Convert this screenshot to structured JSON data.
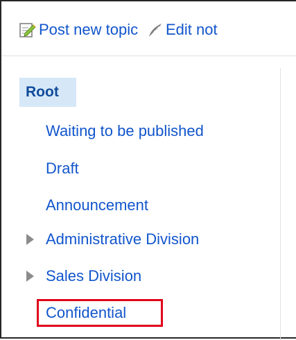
{
  "toolbar": {
    "post_label": "Post new topic",
    "edit_label": "Edit not",
    "post_icon": "notepad-pencil-icon",
    "edit_icon": "feather-quill-icon"
  },
  "tree": {
    "root_label": "Root",
    "items": [
      {
        "label": "Waiting to be published",
        "expandable": false
      },
      {
        "label": "Draft",
        "expandable": false
      },
      {
        "label": "Announcement",
        "expandable": false
      },
      {
        "label": "Administrative Division",
        "expandable": true
      },
      {
        "label": "Sales Division",
        "expandable": true
      },
      {
        "label": "Confidential",
        "expandable": false,
        "highlighted": true
      }
    ]
  },
  "colors": {
    "link": "#1155cc",
    "root_background": "#d6e8f8",
    "root_text": "#0f4b9a",
    "highlight_border": "#e0001a",
    "expander": "#8c8c8c"
  }
}
